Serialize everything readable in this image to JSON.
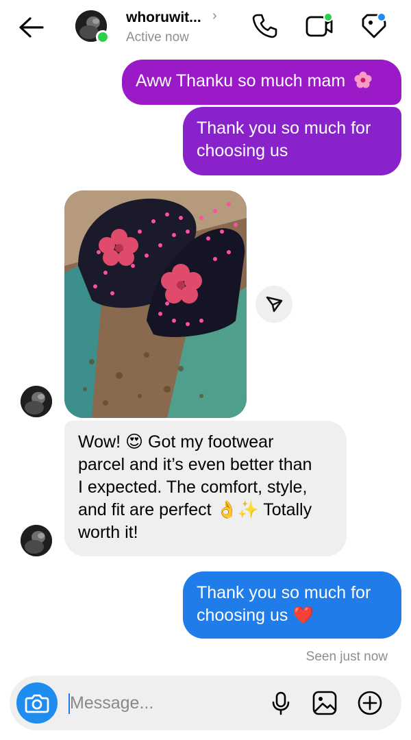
{
  "header": {
    "username": "whoruwit...",
    "status": "Active now",
    "icons": [
      "back-arrow-icon",
      "chevron-right-icon",
      "phone-icon",
      "video-call-icon",
      "tag-icon"
    ],
    "chevron": "›"
  },
  "messages": [
    {
      "side": "sent",
      "text": "Aww Thanku so much mam",
      "emoji": "pink-flower"
    },
    {
      "side": "sent",
      "text_lines": [
        "Thank you so much for",
        "choosing us"
      ]
    },
    {
      "side": "received",
      "type": "photo",
      "description_icon": "photo-sandals"
    },
    {
      "side": "received",
      "text_lines": [
        "Wow! 😍 Got my footwear",
        "parcel and it’s even better than",
        "I expected. The comfort, style,",
        "and fit are perfect 👌✨ Totally",
        "worth it!"
      ]
    },
    {
      "side": "sent",
      "text_lines": [
        "Thank you so much for",
        "choosing us ❤️"
      ]
    }
  ],
  "seen": "Seen just now",
  "composer": {
    "placeholder": "Message...",
    "icons": [
      "camera-icon",
      "microphone-icon",
      "gallery-icon",
      "plus-circle-icon"
    ]
  },
  "colors": {
    "purple": "#8a22cc",
    "blue": "#1f7ce8",
    "received_bg": "#efefef",
    "online": "#2bd14d"
  }
}
